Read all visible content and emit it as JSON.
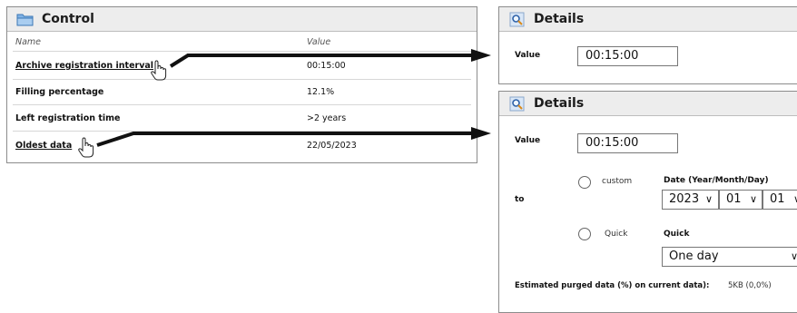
{
  "control": {
    "title": "Control",
    "columns": {
      "name": "Name",
      "value": "Value"
    },
    "rows": [
      {
        "label": "Archive registration interval",
        "value": "00:15:00"
      },
      {
        "label": "Filling percentage",
        "value": "12.1%"
      },
      {
        "label": "Left registration time",
        "value": ">2 years"
      },
      {
        "label": "Oldest data",
        "value": "22/05/2023"
      }
    ]
  },
  "details_top": {
    "title": "Details",
    "value_label": "Value",
    "value": "00:15:00"
  },
  "details_bottom": {
    "title": "Details",
    "value_label": "Value",
    "value": "00:15:00",
    "to_label": "to",
    "custom_label": "custom",
    "date_label": "Date (Year/Month/Day)",
    "year": "2023",
    "month": "01",
    "day": "01",
    "quick_radio_label": "Quick",
    "quick_label": "Quick",
    "quick_value": "One day",
    "estimate_label": "Estimated purged data (%) on current data):",
    "estimate_value": "5KB (0,0%)"
  },
  "icons": {
    "panel_icon": "folder-icon",
    "details_icon": "magnifier-icon",
    "pointer": "hand-pointer-icon",
    "caret": "chevron-down-icon"
  },
  "colors": {
    "header_bg": "#ededed",
    "border": "#8c8c8c",
    "arrow": "#111111",
    "folder": "#4a8fd0"
  }
}
